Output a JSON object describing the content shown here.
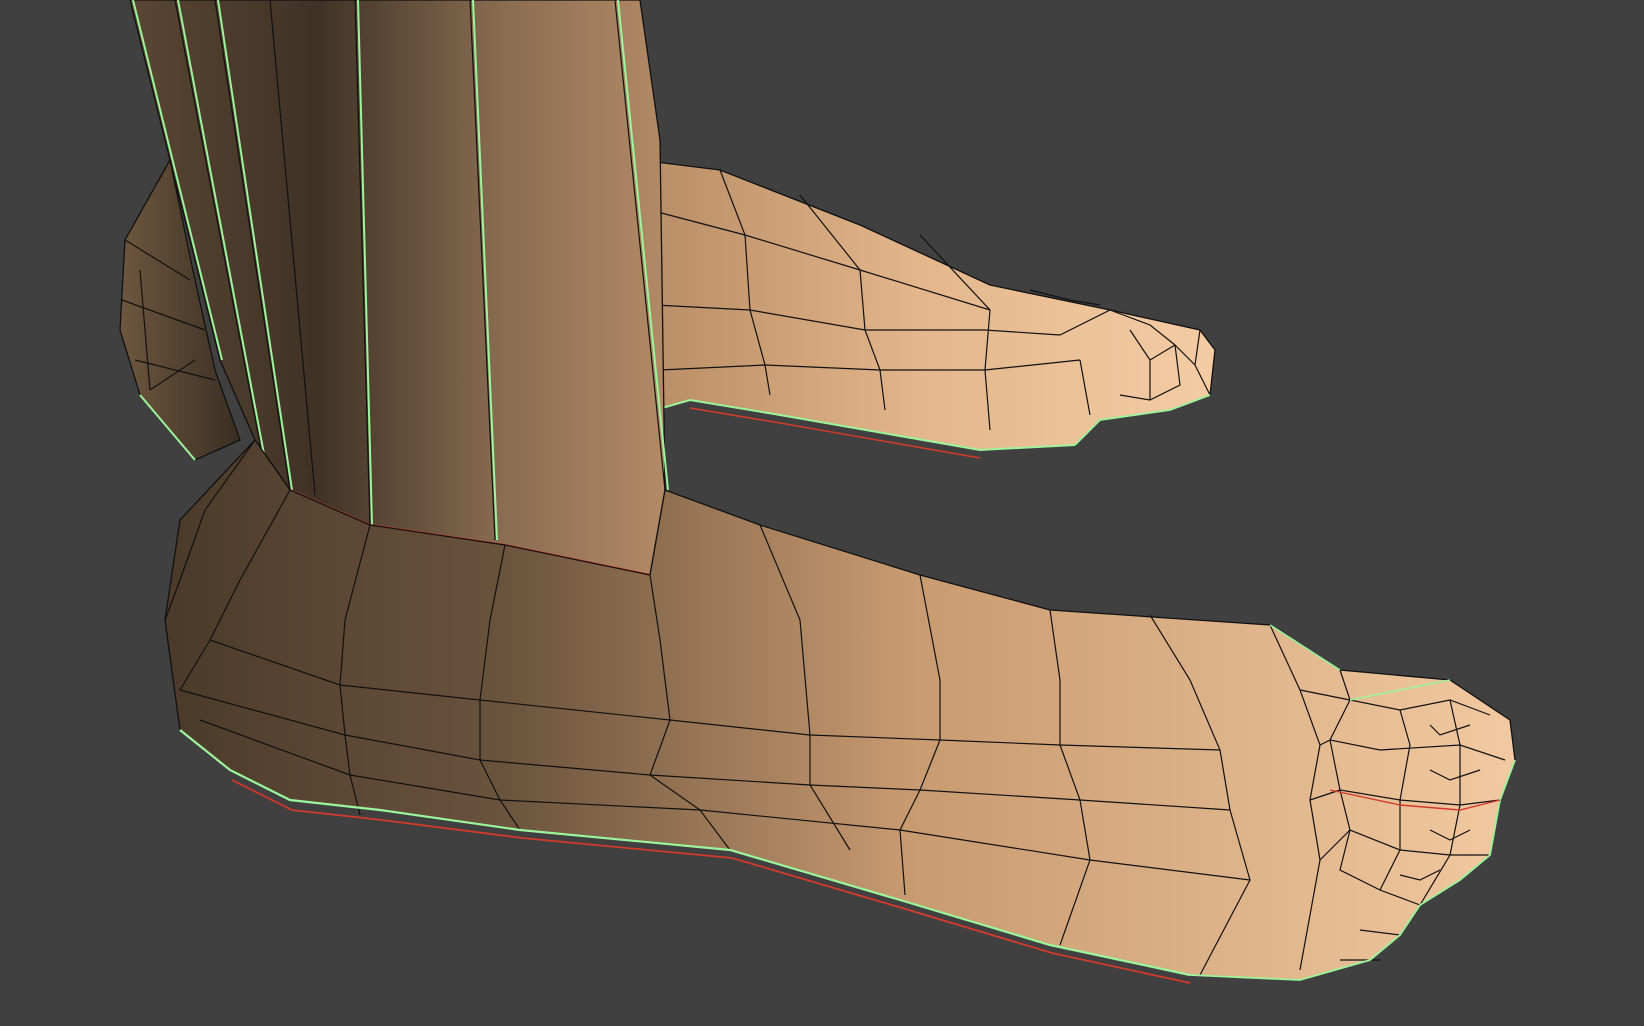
{
  "viewport": {
    "background_color": "#404040",
    "subject": "feet-mesh-wireframe"
  },
  "mesh": {
    "skin_light": "#f0c79c",
    "skin_mid": "#c99b72",
    "skin_dark": "#4e3d2c",
    "wire_color": "#111111",
    "seam_green": "#9cf49c",
    "seam_red": "#d23a2c"
  }
}
